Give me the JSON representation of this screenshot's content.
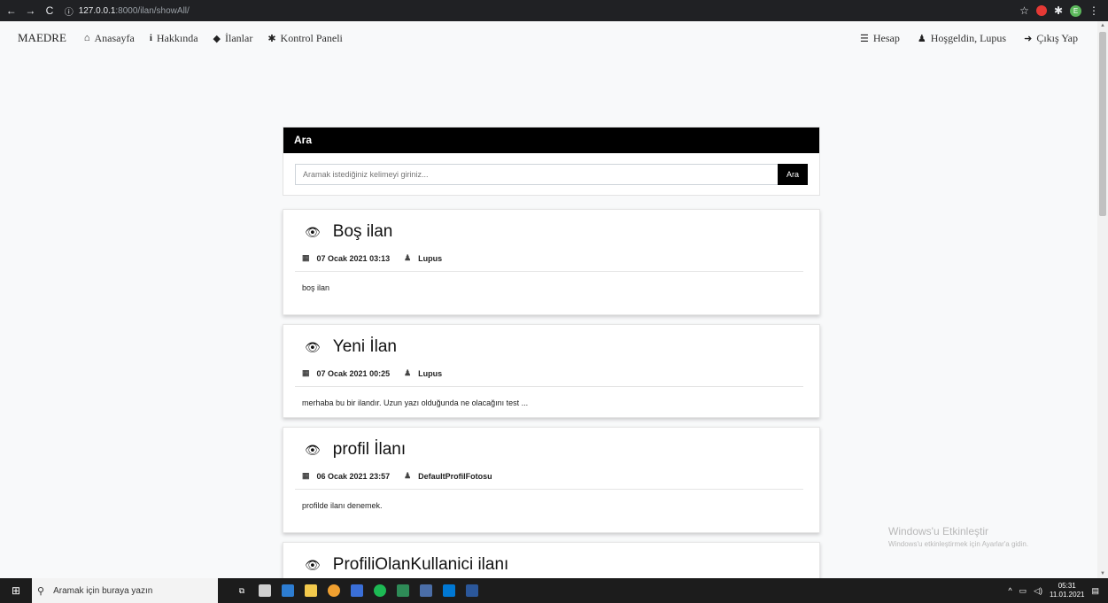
{
  "browser": {
    "url_host": "127.0.0.1",
    "url_path": ":8000/ilan/showAll/"
  },
  "navbar": {
    "brand": "MAEDRE",
    "left_items": [
      {
        "label": "Anasayfa",
        "icon": "home-icon"
      },
      {
        "label": "Hakkında",
        "icon": "info-icon"
      },
      {
        "label": "İlanlar",
        "icon": "tags-icon"
      },
      {
        "label": "Kontrol Paneli",
        "icon": "gear-icon"
      }
    ],
    "right_items": [
      {
        "label": "Hesap",
        "icon": "menu-icon"
      },
      {
        "label": "Hoşgeldin, Lupus",
        "icon": "user-icon"
      },
      {
        "label": "Çıkış Yap",
        "icon": "sign-out-icon"
      }
    ]
  },
  "search": {
    "header": "Ara",
    "placeholder": "Aramak istediğiniz kelimeyi giriniz...",
    "button": "Ara"
  },
  "posts": [
    {
      "title": "Boş ilan",
      "date": "07 Ocak 2021 03:13",
      "author": "Lupus",
      "excerpt": "boş ilan"
    },
    {
      "title": "Yeni İlan",
      "date": "07 Ocak 2021 00:25",
      "author": "Lupus",
      "excerpt": "merhaba bu bir ilandır. Uzun yazı olduğunda ne olacağını test ..."
    },
    {
      "title": "profil İlanı",
      "date": "06 Ocak 2021 23:57",
      "author": "DefaultProfilFotosu",
      "excerpt": "profilde ilanı denemek."
    },
    {
      "title": "ProfiliOlanKullanici ilanı"
    }
  ],
  "watermark": {
    "line1": "Windows'u Etkinleştir",
    "line2": "Windows'u etkinleştirmek için Ayarlar'a gidin."
  },
  "taskbar": {
    "search_placeholder": "Aramak için buraya yazın",
    "time": "05:31",
    "date": "11.01.2021"
  }
}
